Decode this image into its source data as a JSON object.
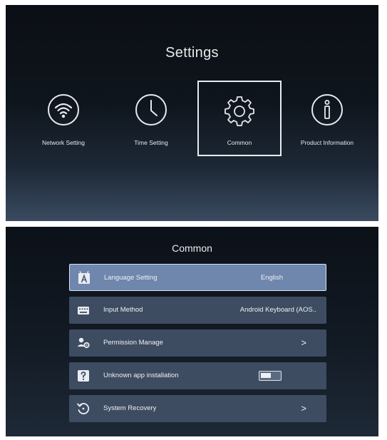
{
  "settings_screen": {
    "title": "Settings",
    "tiles": [
      {
        "label": "Network Setting",
        "icon": "wifi-icon",
        "selected": false
      },
      {
        "label": "Time Setting",
        "icon": "clock-icon",
        "selected": false
      },
      {
        "label": "Common",
        "icon": "gear-icon",
        "selected": true
      },
      {
        "label": "Product Information",
        "icon": "info-icon",
        "selected": false
      }
    ]
  },
  "common_screen": {
    "title": "Common",
    "items": [
      {
        "label": "Language Setting",
        "value": "English",
        "icon": "language-icon",
        "selected": true
      },
      {
        "label": "Input Method",
        "value": "Android Keyboard (AOS..",
        "icon": "keyboard-icon"
      },
      {
        "label": "Permission Manage",
        "value": ">",
        "icon": "permission-icon"
      },
      {
        "label": "Unknown app installation",
        "toggle_on": false,
        "icon": "question-icon"
      },
      {
        "label": "System Recovery",
        "value": ">",
        "icon": "recovery-icon"
      }
    ]
  },
  "colors": {
    "selected_row": "#6f86ad",
    "row": "#3e4c61",
    "panel_dark": "#0b0f15"
  }
}
